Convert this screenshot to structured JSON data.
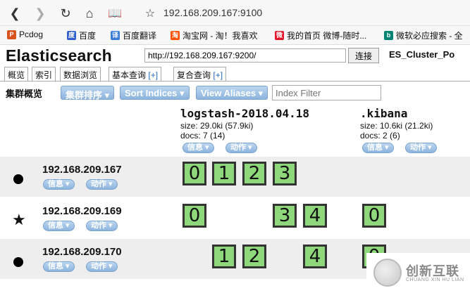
{
  "browser": {
    "url": "192.168.209.167:9100",
    "bookmarks": [
      {
        "label": "Pcdog",
        "color": "#d9531e"
      },
      {
        "label": "百度",
        "color": "#2f5fd1"
      },
      {
        "label": "百度翻译",
        "color": "#3a7bd5"
      },
      {
        "label": "淘宝网 - 淘！我喜欢",
        "color": "#ff5000"
      },
      {
        "label": "我的首页 微博-随时...",
        "color": "#e6162d"
      },
      {
        "label": "微软必应搜索 - 全",
        "color": "#008373"
      }
    ]
  },
  "app": {
    "title": "Elasticsearch",
    "connection_url": "http://192.168.209.167:9200/",
    "connect_label": "连接",
    "cluster_name": "ES_Cluster_Po"
  },
  "tabs": [
    {
      "label": "概览"
    },
    {
      "label": "索引"
    },
    {
      "label": "数据浏览"
    },
    {
      "label": "基本查询",
      "plus": "[+]"
    },
    {
      "label": "复合查询",
      "plus": "[+]"
    }
  ],
  "toolbar": {
    "overview_label": "集群概览",
    "sort_cluster": "集群排序 ▾",
    "sort_indices": "Sort Indices ▾",
    "view_aliases": "View Aliases ▾",
    "filter_placeholder": "Index Filter"
  },
  "indices": [
    {
      "name": "logstash-2018.04.18",
      "size": "size: 29.0ki (57.9ki)",
      "docs": "docs: 7 (14)",
      "info": "信息 ▾",
      "action": "动作 ▾"
    },
    {
      "name": ".kibana",
      "size": "size: 10.6ki (21.2ki)",
      "docs": "docs: 2 (6)",
      "info": "信息 ▾",
      "action": "动作 ▾"
    }
  ],
  "nodes": [
    {
      "ip": "192.168.209.167",
      "marker": "dot",
      "info": "信息 ▾",
      "action": "动作 ▾",
      "shards": [
        "0",
        "1",
        "2",
        "3"
      ],
      "kibana": ""
    },
    {
      "ip": "192.168.209.169",
      "marker": "star",
      "info": "信息 ▾",
      "action": "动作 ▾",
      "shards": [
        "0",
        "3",
        "4"
      ],
      "kibana": "0"
    },
    {
      "ip": "192.168.209.170",
      "marker": "dot",
      "info": "信息 ▾",
      "action": "动作 ▾",
      "shards": [
        "1",
        "2",
        "4"
      ],
      "kibana": "0"
    }
  ],
  "watermark": {
    "text": "创新互联",
    "sub": "CHUANG XIN HU LIAN"
  }
}
